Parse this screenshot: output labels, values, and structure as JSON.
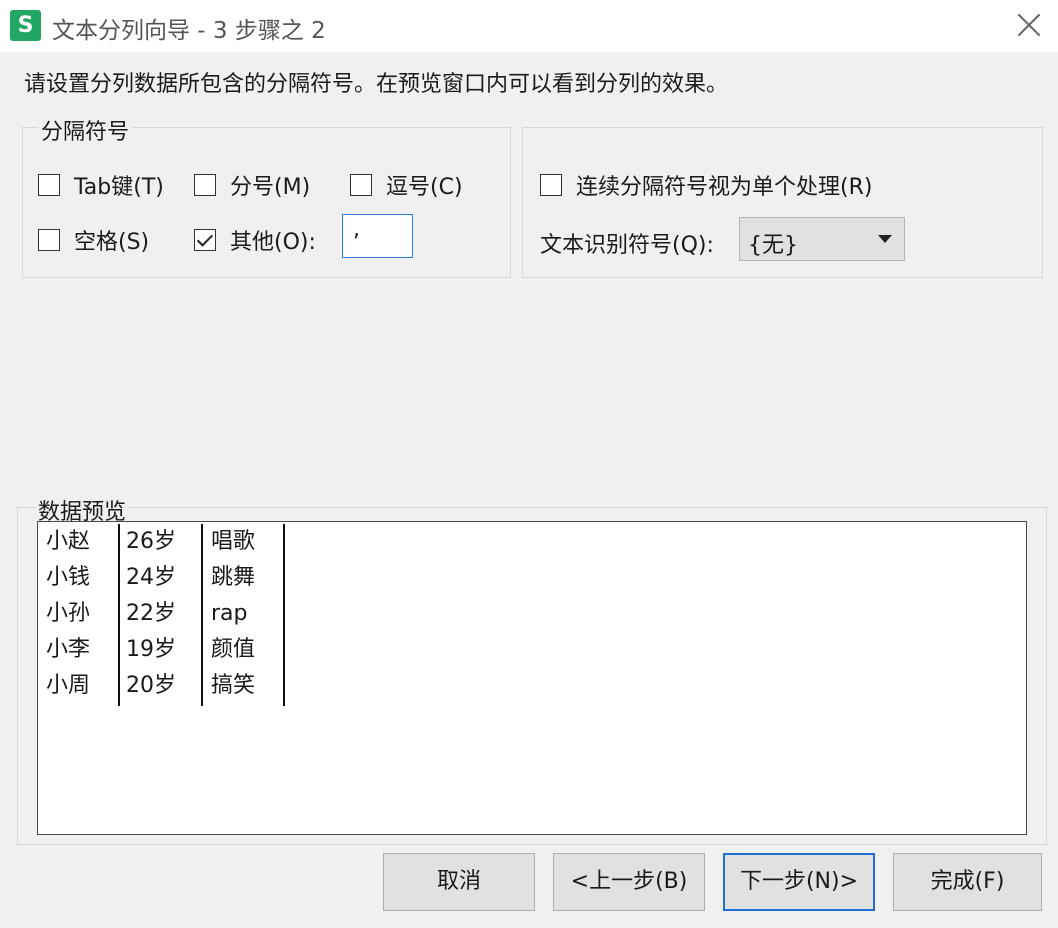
{
  "window": {
    "app_icon_glyph": "S",
    "title": "文本分列向导 - 3 步骤之 2"
  },
  "instruction": "请设置分列数据所包含的分隔符号。在预览窗口内可以看到分列的效果。",
  "delimiters": {
    "legend": "分隔符号",
    "tab": {
      "label": "Tab键(T)",
      "checked": false
    },
    "semicolon": {
      "label": "分号(M)",
      "checked": false
    },
    "comma": {
      "label": "逗号(C)",
      "checked": false
    },
    "space": {
      "label": "空格(S)",
      "checked": false
    },
    "other": {
      "label": "其他(O):",
      "checked": true,
      "value": ","
    }
  },
  "options": {
    "consecutive": {
      "label": "连续分隔符号视为单个处理(R)",
      "checked": false
    },
    "qualifier_label": "文本识别符号(Q):",
    "qualifier_value": "{无}"
  },
  "preview": {
    "legend": "数据预览",
    "columns": [
      [
        "小赵",
        "小钱",
        "小孙",
        "小李",
        "小周"
      ],
      [
        "26岁",
        "24岁",
        "22岁",
        "19岁",
        "20岁"
      ],
      [
        "唱歌",
        "跳舞",
        "rap",
        "颜值",
        "搞笑"
      ]
    ]
  },
  "buttons": {
    "cancel": "取消",
    "back": "<上一步(B)",
    "next": "下一步(N)>",
    "finish": "完成(F)"
  },
  "colors": {
    "app_icon": "#22a664",
    "focus_border": "#1e6fd6"
  }
}
